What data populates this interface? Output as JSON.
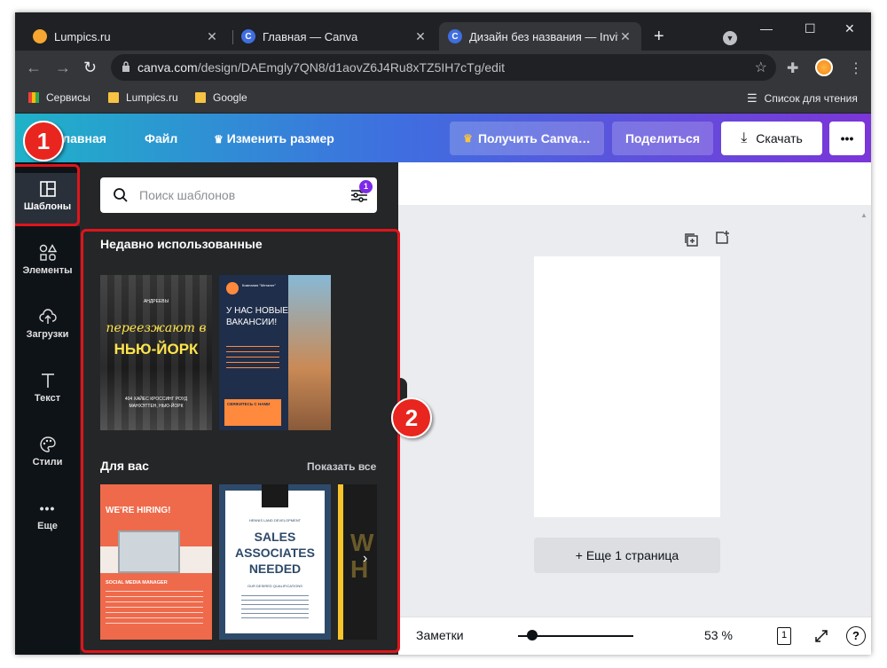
{
  "browser": {
    "tabs": [
      {
        "title": "Lumpics.ru",
        "favicon": "orange-circle"
      },
      {
        "title": "Главная — Canva",
        "favicon": "canva-logo"
      },
      {
        "title": "Дизайн без названия — Invitat",
        "favicon": "canva-logo",
        "active": true
      }
    ],
    "url_domain": "canva.com",
    "url_path": "/design/DAEmgly7QN8/d1aovZ6J4Ru8xTZ5IH7cTg/edit",
    "bookmarks": [
      "Сервисы",
      "Lumpics.ru",
      "Google"
    ],
    "reading_list": "Список для чтения"
  },
  "canva_header": {
    "home": "Главная",
    "file": "Файл",
    "resize": "Изменить размер",
    "pro": "Получить Canva…",
    "share": "Поделиться",
    "download": "Скачать",
    "more": "•••"
  },
  "sidebar": {
    "items": [
      {
        "label": "Шаблоны",
        "icon": "layout-icon"
      },
      {
        "label": "Элементы",
        "icon": "shapes-icon"
      },
      {
        "label": "Загрузки",
        "icon": "cloud-upload-icon"
      },
      {
        "label": "Текст",
        "icon": "text-icon"
      },
      {
        "label": "Стили",
        "icon": "palette-icon"
      },
      {
        "label": "Еще",
        "icon": "more-icon"
      }
    ]
  },
  "panel": {
    "search_placeholder": "Поиск шаблонов",
    "filter_count": "1",
    "recent_title": "Недавно использованные",
    "for_you_title": "Для вас",
    "show_all": "Показать все",
    "recent": [
      {
        "line1": "АНДРЕЕВЫ",
        "line2": "переезжают в",
        "line3": "НЬЮ-ЙОРК",
        "line4": "404 ХАЙЕС КРОССИНГ РОУД",
        "line5": "МАНХЭТТЕН, НЬЮ-ЙОРК"
      },
      {
        "line1": "Компания \"Метанит\"",
        "line2": "У НАС НОВЫЕ ВАКАНСИИ!",
        "line3": "СВЯЖИТЕСЬ С НАМИ"
      }
    ],
    "for_you": [
      {
        "line1": "WE'RE HIRING!",
        "line2": "SOCIAL MEDIA MANAGER"
      },
      {
        "line1": "HENNIS LAND DEVELOPMENT",
        "line2": "SALES ASSOCIATES NEEDED",
        "line3": "OUR DESIRED QUALIFICATIONS"
      },
      {
        "line1": "W",
        "line2": "H"
      }
    ]
  },
  "canvas": {
    "add_page": "+ Еще 1 страница",
    "notes": "Заметки",
    "zoom": "53 %",
    "page_count": "1"
  },
  "annotations": {
    "badge1": "1",
    "badge2": "2",
    "highlight_color": "#e0141b"
  },
  "colors": {
    "canva_purple": "#7d2ae8",
    "sidebar_bg": "#0e1318",
    "panel_bg": "#252627",
    "badge_red": "#e8251e"
  }
}
